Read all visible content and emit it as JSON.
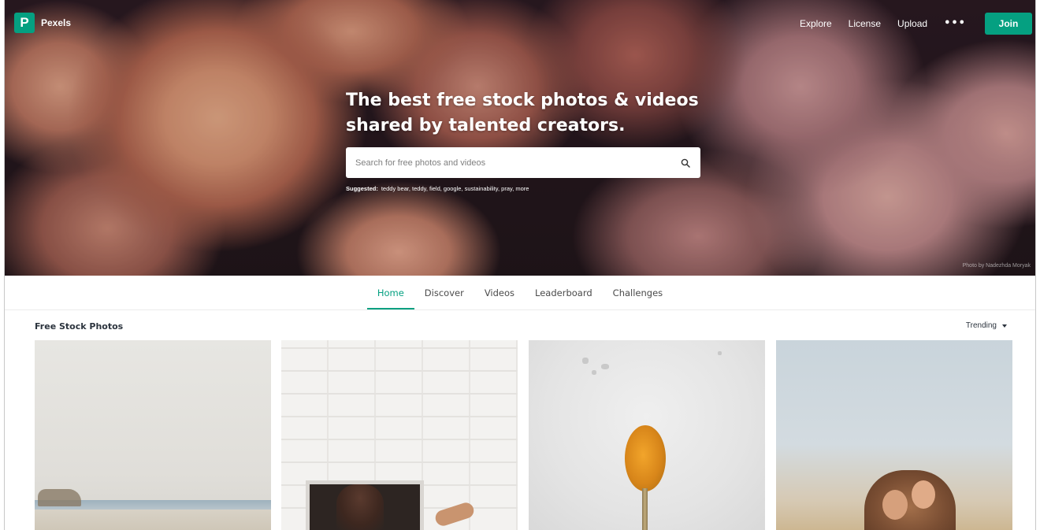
{
  "brand": {
    "logo_letter": "P",
    "name": "Pexels"
  },
  "header": {
    "nav": [
      "Explore",
      "License",
      "Upload"
    ],
    "more": "•••",
    "join_label": "Join"
  },
  "hero": {
    "title_line1": "The best free stock photos & videos",
    "title_line2": "shared by talented creators.",
    "search_placeholder": "Search for free photos and videos",
    "suggested_label": "Suggested:",
    "suggested_items": "teddy bear, teddy, field, google, sustainability, pray, more",
    "photo_credit": "Photo by Nadezhda Moryak"
  },
  "tabs": [
    {
      "label": "Home",
      "active": true
    },
    {
      "label": "Discover",
      "active": false
    },
    {
      "label": "Videos",
      "active": false
    },
    {
      "label": "Leaderboard",
      "active": false
    },
    {
      "label": "Challenges",
      "active": false
    }
  ],
  "section": {
    "title": "Free Stock Photos",
    "sort_label": "Trending"
  },
  "colors": {
    "accent": "#05a081",
    "text": "#2c343e"
  },
  "icons": {
    "search": "search-icon",
    "caret": "chevron-down-icon",
    "more": "more-horizontal-icon"
  }
}
